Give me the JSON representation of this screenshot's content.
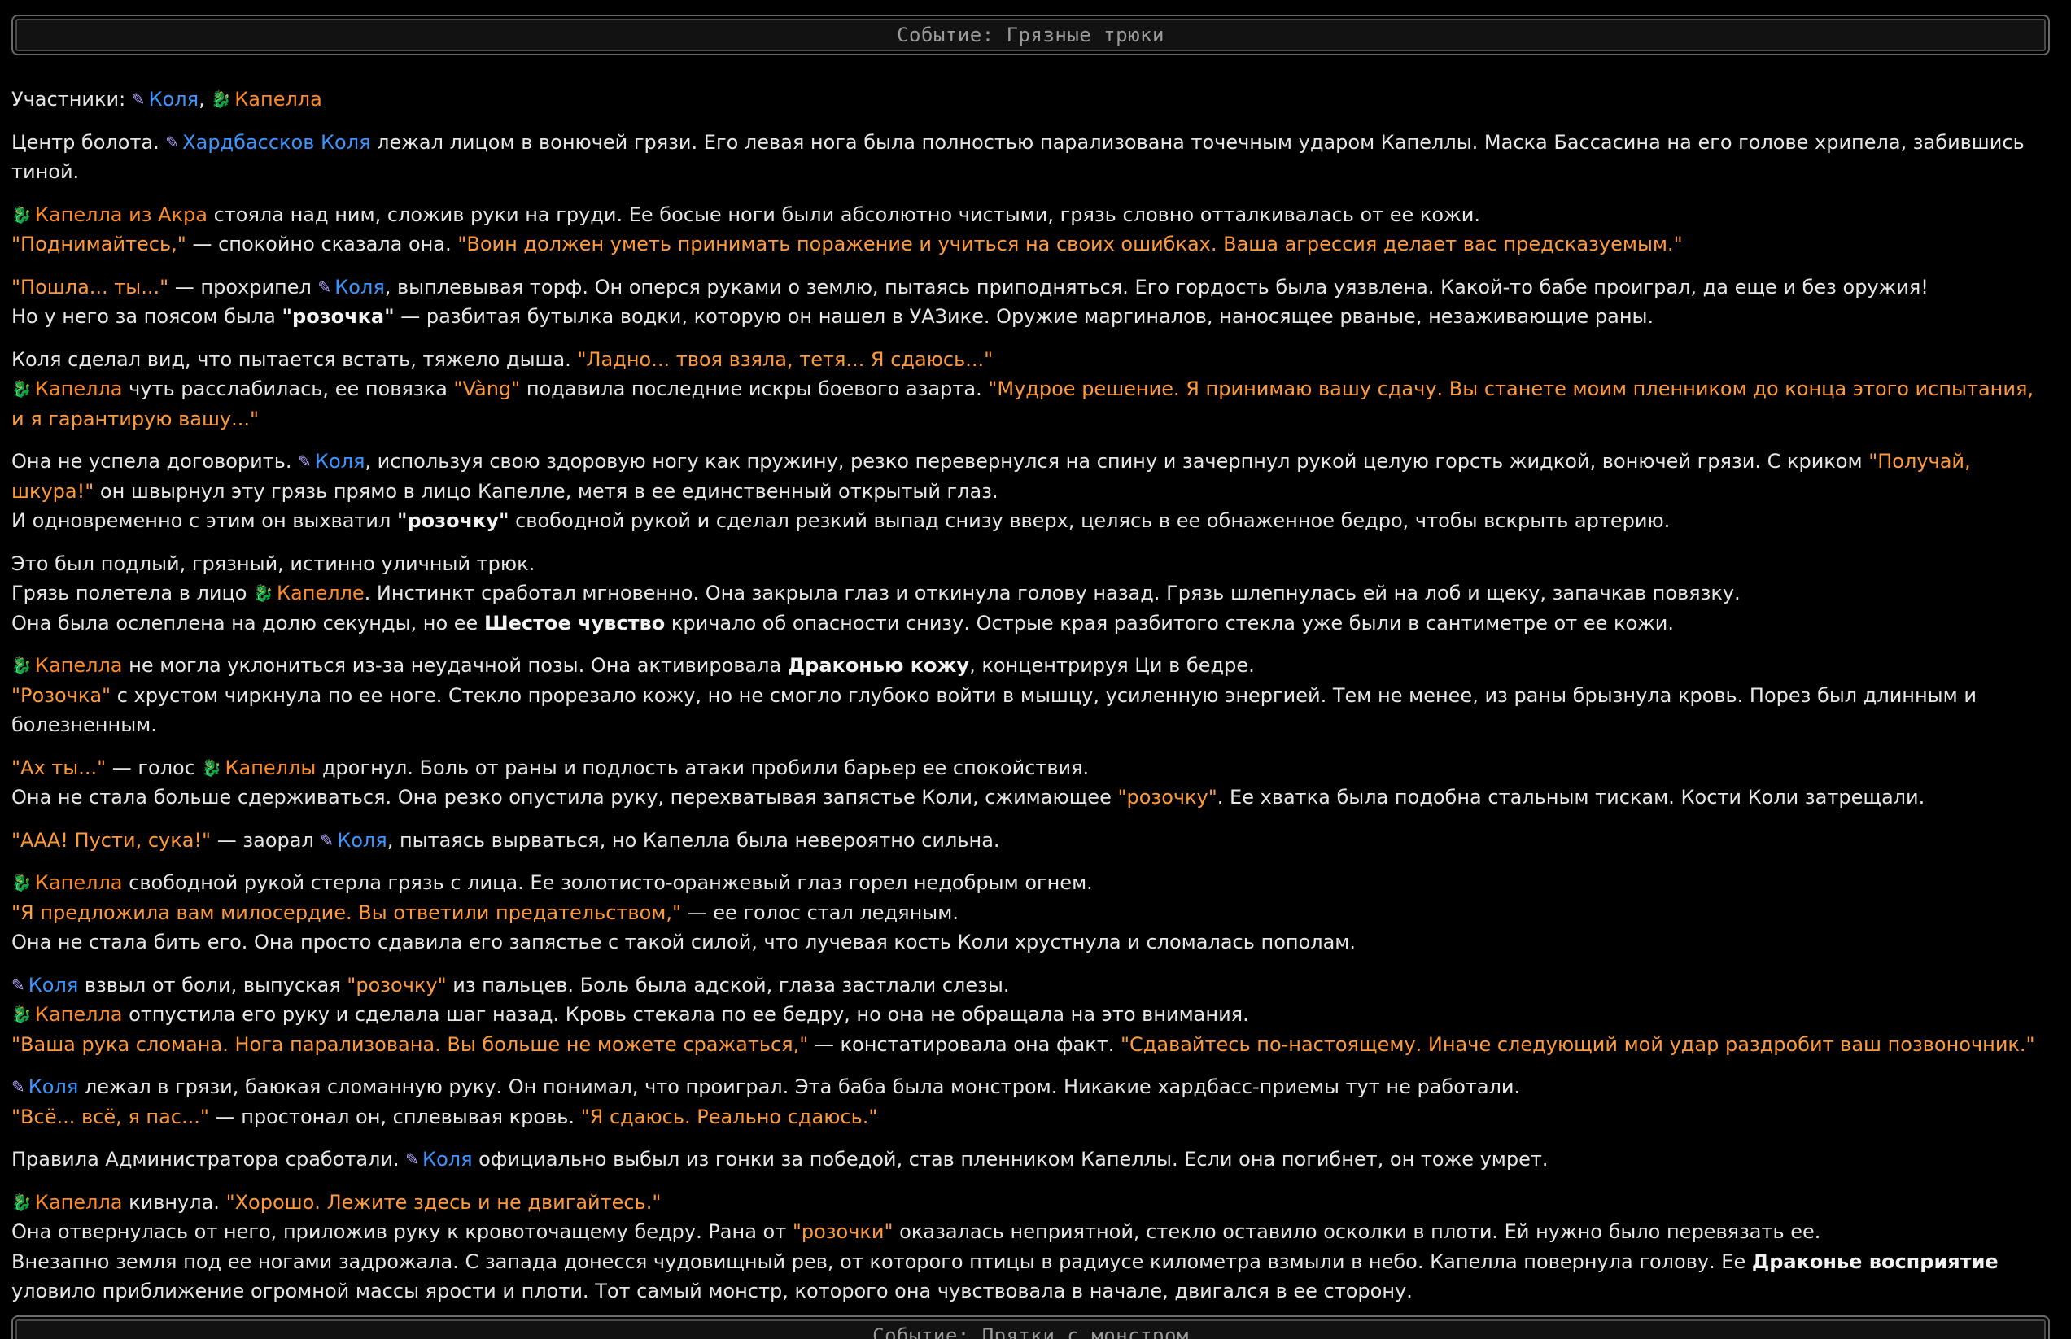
{
  "header_top": "Событие: Грязные трюки",
  "header_bottom": "Событие: Прятки с монстром",
  "icons": {
    "kolya": "pen-icon",
    "capella": "dragon-icon"
  },
  "colors": {
    "kolya": "#3d96ff",
    "capella": "#ff8a2a",
    "quote": "#ff9a3c"
  },
  "participants": {
    "label": "Участники:",
    "kolya": "Коля",
    "sep": ",",
    "capella": "Капелла"
  },
  "p1": {
    "pre": "Центр болота.",
    "name": "Хардбассков Коля",
    "rest": " лежал лицом в вонючей грязи. Его левая нога была полностью парализована точечным ударом Капеллы. Маска Бассасина на его голове хрипела, забившись тиной."
  },
  "p2": {
    "name": "Капелла из Акра",
    "rest1": " стояла над ним, сложив руки на груди. Ее босые ноги были абсолютно чистыми, грязь словно отталкивалась от ее кожи.",
    "q1": "\"Поднимайтесь,\"",
    "mid": " — спокойно сказала она. ",
    "q2": "\"Воин должен уметь принимать поражение и учиться на своих ошибках. Ваша агрессия делает вас предсказуемым.\""
  },
  "p3": {
    "q1": "\"Пошла... ты...\"",
    "mid1": " — прохрипел ",
    "name": "Коля",
    "rest1": ", выплевывая торф. Он оперся руками о землю, пытаясь приподняться. Его гордость была уязвлена. Какой-то бабе проиграл, да еще и без оружия!",
    "pre2": "Но у него за поясом была ",
    "q2": "\"розочка\"",
    "rest2": " — разбитая бутылка водки, которую он нашел в УАЗике. Оружие маргиналов, наносящее рваные, незаживающие раны."
  },
  "p4": {
    "pre1": "Коля сделал вид, что пытается встать, тяжело дыша. ",
    "q1": "\"Ладно... твоя взяла, тетя... Я сдаюсь...\"",
    "name": "Капелла",
    "mid2": " чуть расслабилась, ее повязка ",
    "q2": "\"Vàng\"",
    "mid3": " подавила последние искры боевого азарта. ",
    "q3": "\"Мудрое решение. Я принимаю вашу сдачу. Вы станете моим пленником до конца этого испытания, и я гарантирую вашу...\""
  },
  "p5": {
    "pre1": "Она не успела договорить. ",
    "name": "Коля",
    "mid1": ", используя свою здоровую ногу как пружину, резко перевернулся на спину и зачерпнул рукой целую горсть жидкой, вонючей грязи. С криком ",
    "q1": "\"Получай, шкура!\"",
    "rest1": " он швырнул эту грязь прямо в лицо Капелле, метя в ее единственный открытый глаз.",
    "pre2": "И одновременно с этим он выхватил ",
    "q2": "\"розочку\"",
    "rest2": " свободной рукой и сделал резкий выпад снизу вверх, целясь в ее обнаженное бедро, чтобы вскрыть артерию."
  },
  "p6": {
    "line1": "Это был подлый, грязный, истинно уличный трюк.",
    "pre2": "Грязь полетела в лицо ",
    "name": "Капелле",
    "rest2": ". Инстинкт сработал мгновенно. Она закрыла глаз и откинула голову назад. Грязь шлепнулась ей на лоб и щеку, запачкав повязку.",
    "pre3": "Она была ослеплена на долю секунды, но ее ",
    "bold3": "Шестое чувство",
    "rest3": " кричало об опасности снизу. Острые края разбитого стекла уже были в сантиметре от ее кожи."
  },
  "p7": {
    "name": "Капелла",
    "mid1": " не могла уклониться из-за неудачной позы. Она активировала ",
    "bold1": "Драконью кожу",
    "rest1": ", концентрируя Ци в бедре.",
    "q2": "\"Розочка\"",
    "rest2": " с хрустом чиркнула по ее ноге. Стекло прорезало кожу, но не смогло глубоко войти в мышцу, усиленную энергией. Тем не менее, из раны брызнула кровь. Порез был длинным и болезненным."
  },
  "p8": {
    "q1": "\"Ах ты...\"",
    "mid1": " — голос ",
    "name": "Капеллы",
    "rest1": " дрогнул. Боль от раны и подлость атаки пробили барьер ее спокойствия.",
    "pre2": "Она не стала больше сдерживаться. Она резко опустила руку, перехватывая запястье Коли, сжимающее ",
    "q2": "\"розочку\"",
    "rest2": ". Ее хватка была подобна стальным тискам. Кости Коли затрещали."
  },
  "p9": {
    "q1": "\"ААА! Пусти, сука!\"",
    "mid1": " — заорал ",
    "name": "Коля",
    "rest1": ", пытаясь вырваться, но Капелла была невероятно сильна."
  },
  "p10": {
    "name": "Капелла",
    "rest1": " свободной рукой стерла грязь с лица. Ее золотисто-оранжевый глаз горел недобрым огнем.",
    "q2": "\"Я предложила вам милосердие. Вы ответили предательством,\"",
    "rest2": " — ее голос стал ледяным.",
    "line3": "Она не стала бить его. Она просто сдавила его запястье с такой силой, что лучевая кость Коли хрустнула и сломалась пополам."
  },
  "p11": {
    "name1": "Коля",
    "mid1": " взвыл от боли, выпуская ",
    "q1": "\"розочку\"",
    "rest1": " из пальцев. Боль была адской, глаза застлали слезы.",
    "name2": "Капелла",
    "rest2": " отпустила его руку и сделала шаг назад. Кровь стекала по ее бедру, но она не обращала на это внимания.",
    "q3": "\"Ваша рука сломана. Нога парализована. Вы больше не можете сражаться,\"",
    "mid3": " — констатировала она факт. ",
    "q4": "\"Сдавайтесь по-настоящему. Иначе следующий мой удар раздробит ваш позвоночник.\""
  },
  "p12": {
    "name": "Коля",
    "rest1": " лежал в грязи, баюкая сломанную руку. Он понимал, что проиграл. Эта баба была монстром. Никакие хардбасс-приемы тут не работали.",
    "q2": "\"Всё... всё, я пас...\"",
    "mid2": " — простонал он, сплевывая кровь. ",
    "q3": "\"Я сдаюсь. Реально сдаюсь.\""
  },
  "p13": {
    "pre": "Правила Администратора сработали. ",
    "name": "Коля",
    "rest": " официально выбыл из гонки за победой, став пленником Капеллы. Если она погибнет, он тоже умрет."
  },
  "p14": {
    "name": "Капелла",
    "mid1": " кивнула. ",
    "q1": "\"Хорошо. Лежите здесь и не двигайтесь.\"",
    "pre2": "Она отвернулась от него, приложив руку к кровоточащему бедру. Рана от ",
    "q2": "\"розочки\"",
    "rest2": " оказалась неприятной, стекло оставило осколки в плоти. Ей нужно было перевязать ее.",
    "pre3": "Внезапно земля под ее ногами задрожала. С запада донесся чудовищный рев, от которого птицы в радиусе километра взмыли в небо. Капелла повернула голову. Ее ",
    "bold3": "Драконье восприятие",
    "rest3": " уловило приближение огромной массы ярости и плоти. Тот самый монстр, которого она чувствовала в начале, двигался в ее сторону."
  }
}
